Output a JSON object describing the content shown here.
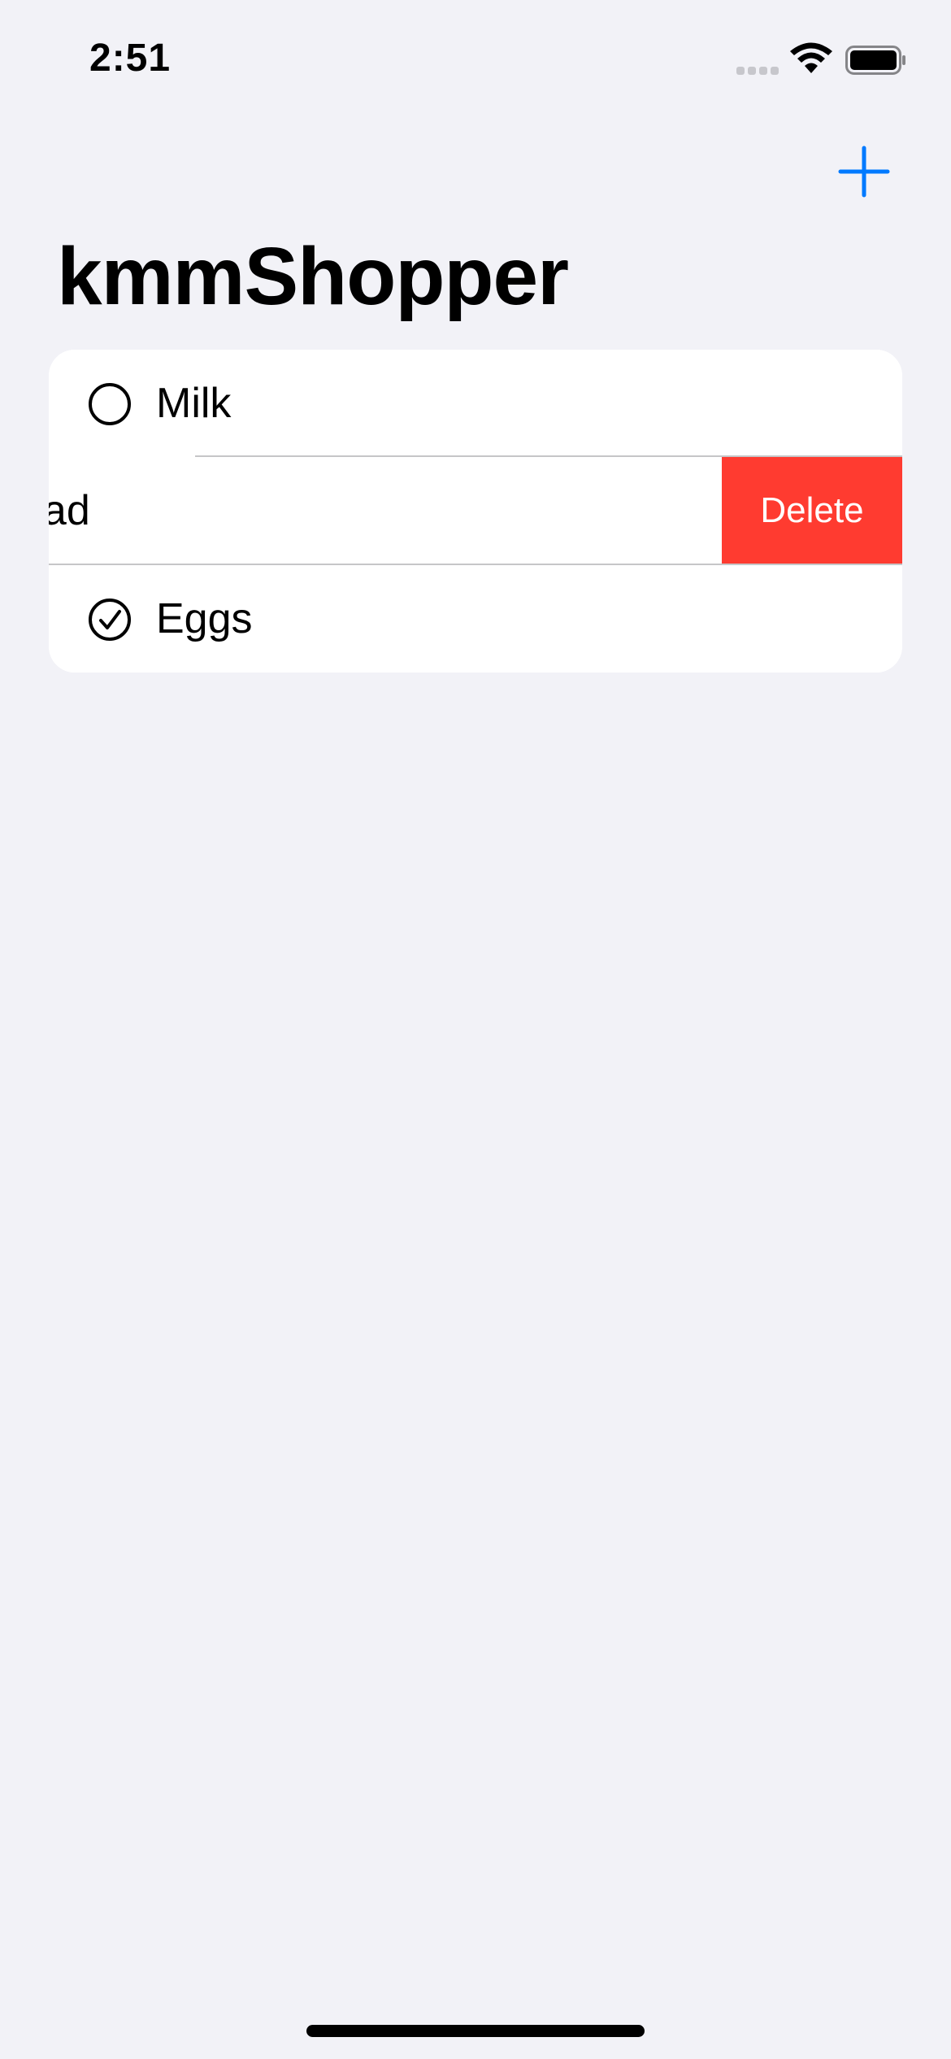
{
  "status_bar": {
    "time": "2:51"
  },
  "nav": {
    "title": "kmmShopper",
    "add_icon": "plus-icon"
  },
  "list": {
    "items": [
      {
        "label": "Milk",
        "checked": false,
        "icon": "circle-icon"
      },
      {
        "label": "Bread",
        "checked": false,
        "icon": "circle-icon",
        "swiped": true
      },
      {
        "label": "Eggs",
        "checked": true,
        "icon": "checkmark-circle-icon"
      }
    ],
    "delete_label": "Delete"
  },
  "colors": {
    "background": "#F2F2F7",
    "accent": "#007AFF",
    "destructive": "#FF3B30",
    "separator": "#C6C6C8"
  }
}
